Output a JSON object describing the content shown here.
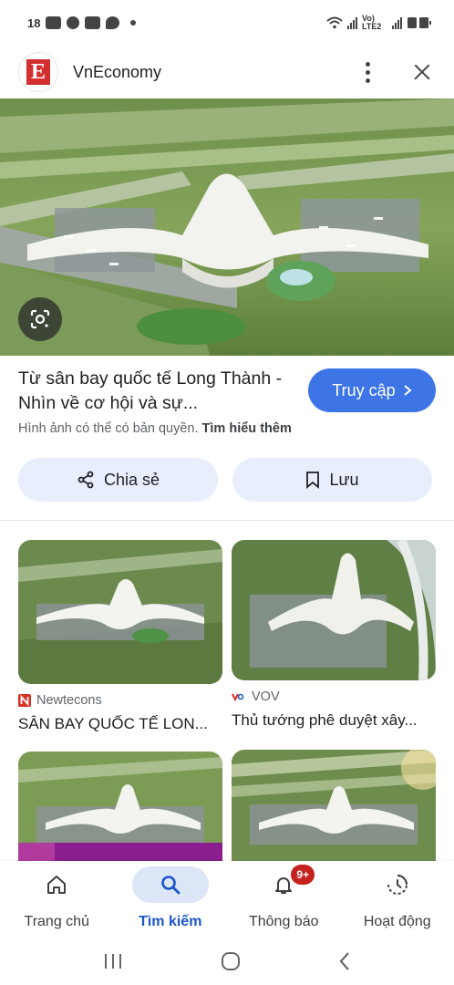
{
  "status_bar": {
    "left_text": "18",
    "right_text": "Vo) LTE2",
    "icons": [
      "notification-icon",
      "facebook-icon",
      "gallery-icon",
      "chat-icon",
      "wifi-icon",
      "signal-icon",
      "battery-icon"
    ]
  },
  "header": {
    "source_name": "VnEconomy",
    "favicon_letter": "E",
    "favicon_color": "#d32f2f"
  },
  "result": {
    "title": "Từ sân bay quốc tế Long Thành - Nhìn về cơ hội và sự...",
    "visit_label": "Truy cập",
    "copyright_text": "Hình ảnh có thể có bản quyền.",
    "learn_more": "Tìm hiểu thêm"
  },
  "actions": {
    "share_label": "Chia sẻ",
    "save_label": "Lưu"
  },
  "related": [
    {
      "source": "Newtecons",
      "title": "SÂN BAY QUỐC TẾ LON..."
    },
    {
      "source": "VOV",
      "title": "Thủ tướng phê duyệt xây..."
    }
  ],
  "bottom_nav": [
    {
      "label": "Trang chủ",
      "icon": "home-icon"
    },
    {
      "label": "Tìm kiếm",
      "icon": "search-icon",
      "active": true
    },
    {
      "label": "Thông báo",
      "icon": "bell-icon",
      "badge": "9+"
    },
    {
      "label": "Hoạt động",
      "icon": "activity-icon"
    }
  ],
  "colors": {
    "accent": "#3d74e6",
    "active_nav": "#1a56c9",
    "chip_bg": "#e8eefb",
    "badge": "#c5221f"
  }
}
